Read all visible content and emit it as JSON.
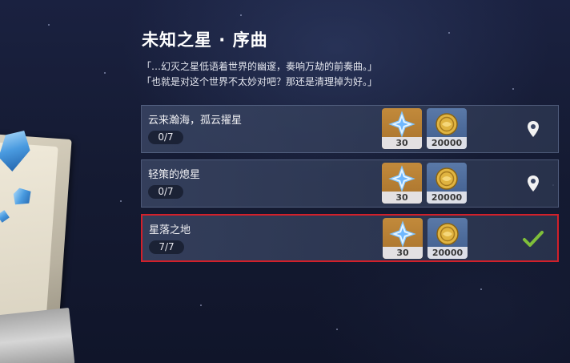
{
  "event": {
    "title": "未知之星 · 序曲",
    "quotes": [
      "「…幻灭之星低语着世界的幽邃，奏响万劫的前奏曲。」",
      "「也就是对这个世界不太妙对吧？那还是清理掉为好。」"
    ]
  },
  "quests": [
    {
      "name": "云来瀚海，孤云擢星",
      "progress": "0/7",
      "rewards": [
        {
          "icon": "primogem-icon",
          "count": "30"
        },
        {
          "icon": "mora-icon",
          "count": "20000"
        }
      ],
      "action_icon": "map-pin-icon",
      "selected": false
    },
    {
      "name": "轻策的熄星",
      "progress": "0/7",
      "rewards": [
        {
          "icon": "primogem-icon",
          "count": "30"
        },
        {
          "icon": "mora-icon",
          "count": "20000"
        }
      ],
      "action_icon": "map-pin-icon",
      "selected": false
    },
    {
      "name": "星落之地",
      "progress": "7/7",
      "rewards": [
        {
          "icon": "primogem-icon",
          "count": "30"
        },
        {
          "icon": "mora-icon",
          "count": "20000"
        }
      ],
      "action_icon": "check-icon",
      "selected": true
    }
  ],
  "colors": {
    "highlight_border": "#d2202a",
    "check_green": "#7fbf3a",
    "primogem_bg": "#c28a3b",
    "mora_bg": "#5a79a8"
  }
}
